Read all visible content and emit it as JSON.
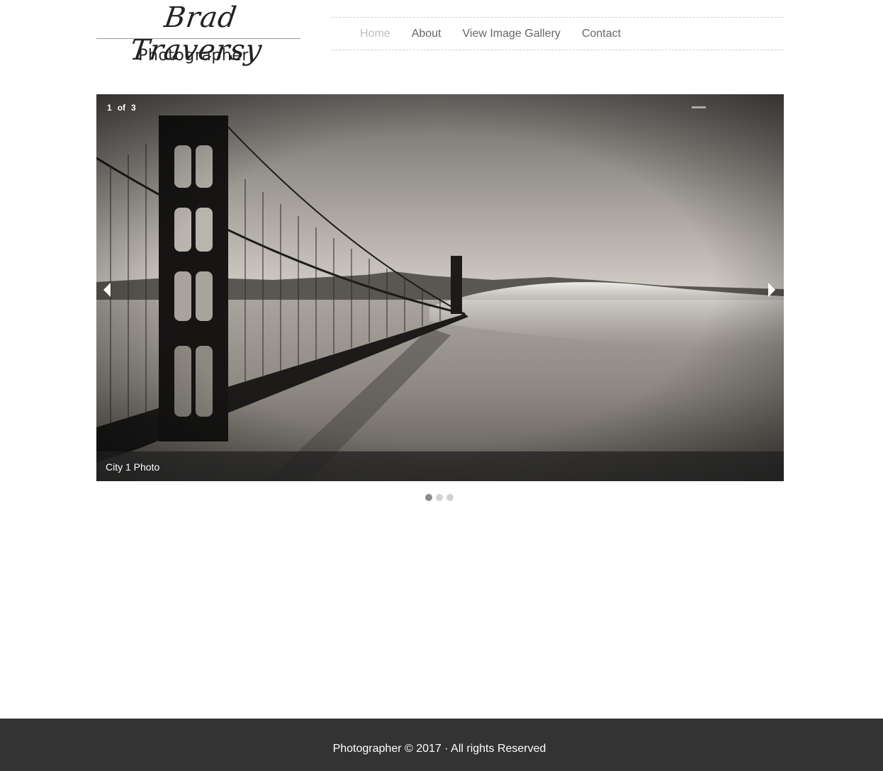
{
  "header": {
    "logo_name": "Brad Traversy",
    "logo_subtitle": "Photographer"
  },
  "nav": {
    "items": [
      {
        "label": "Home",
        "active": true
      },
      {
        "label": "About",
        "active": false
      },
      {
        "label": "View Image Gallery",
        "active": false
      },
      {
        "label": "Contact",
        "active": false
      }
    ]
  },
  "slider": {
    "current": "1",
    "of_label": "of",
    "total": "3",
    "caption": "City 1 Photo",
    "image_subject": "golden-gate-bridge-in-fog",
    "dots": [
      true,
      false,
      false
    ]
  },
  "footer": {
    "text": "Photographer © 2017 · All rights Reserved"
  },
  "colors": {
    "footer_bg": "#333333",
    "nav_text": "#666666",
    "nav_active": "#bdbdbd"
  }
}
